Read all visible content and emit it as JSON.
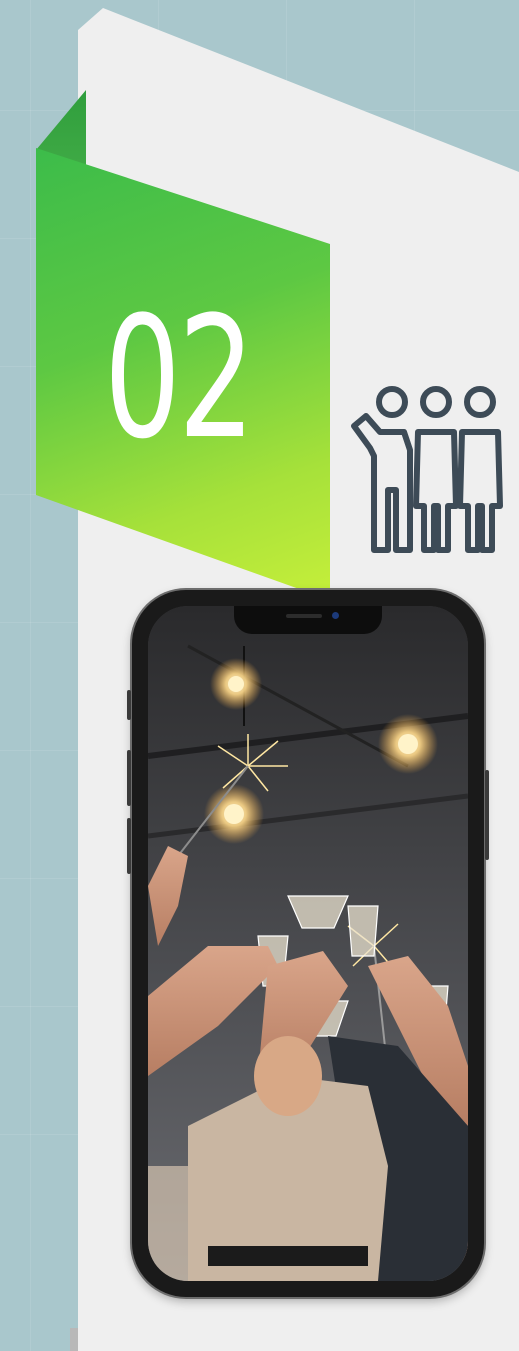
{
  "banner": {
    "number": "02"
  },
  "icons": {
    "people": "people-group-icon"
  },
  "colors": {
    "background": "#a9c7cc",
    "card": "#efefef",
    "banner_start": "#3cbc4a",
    "banner_end": "#c6ef3a",
    "icon_stroke": "#3d4b57"
  },
  "phone": {
    "content": "party-celebration-photo"
  }
}
